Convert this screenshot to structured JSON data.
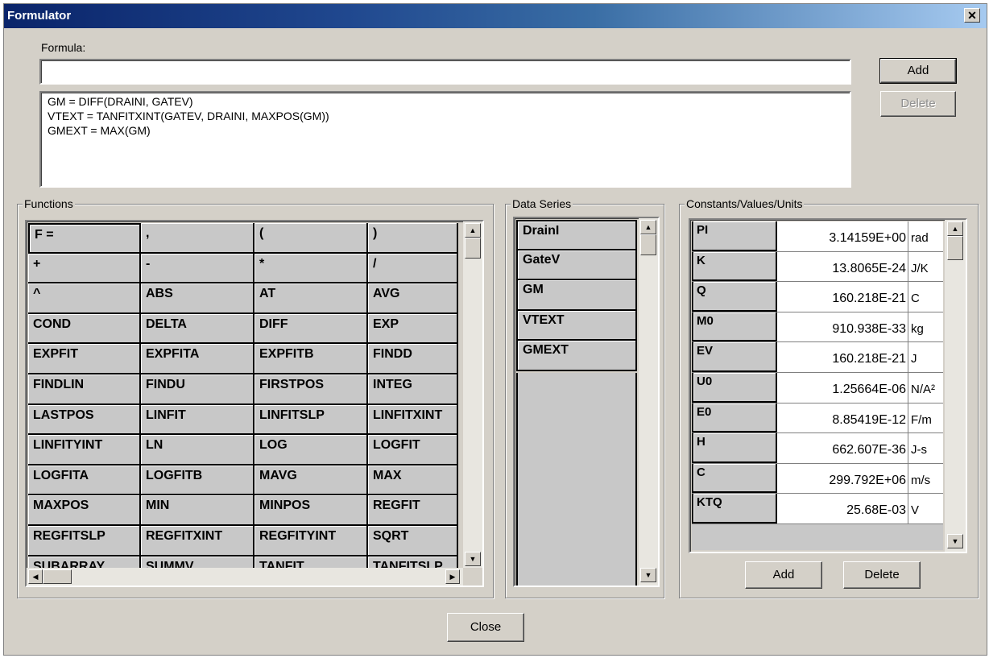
{
  "window": {
    "title": "Formulator",
    "close_glyph": "✕"
  },
  "formula": {
    "label": "Formula:",
    "value": "",
    "add_label": "Add",
    "delete_label": "Delete",
    "list": [
      "GM = DIFF(DRAINI, GATEV)",
      "VTEXT = TANFITXINT(GATEV, DRAINI, MAXPOS(GM))",
      "GMEXT = MAX(GM)"
    ]
  },
  "functions": {
    "title": "Functions",
    "cells": [
      "F =",
      ",",
      "(",
      ")",
      "+",
      "-",
      "*",
      "/",
      "^",
      "ABS",
      "AT",
      "AVG",
      "COND",
      "DELTA",
      "DIFF",
      "EXP",
      "EXPFIT",
      "EXPFITA",
      "EXPFITB",
      "FINDD",
      "FINDLIN",
      "FINDU",
      "FIRSTPOS",
      "INTEG",
      "LASTPOS",
      "LINFIT",
      "LINFITSLP",
      "LINFITXINT",
      "LINFITYINT",
      "LN",
      "LOG",
      "LOGFIT",
      "LOGFITA",
      "LOGFITB",
      "MAVG",
      "MAX",
      "MAXPOS",
      "MIN",
      "MINPOS",
      "REGFIT",
      "REGFITSLP",
      "REGFITXINT",
      "REGFITYINT",
      "SQRT",
      "SUBARRAY",
      "SUMMV",
      "TANFIT",
      "TANFITSLP"
    ]
  },
  "data_series": {
    "title": "Data Series",
    "items": [
      "DrainI",
      "GateV",
      "GM",
      "VTEXT",
      "GMEXT"
    ]
  },
  "constants": {
    "title": "Constants/Values/Units",
    "rows": [
      {
        "name": "PI",
        "value": "3.14159E+00",
        "unit": "rad"
      },
      {
        "name": "K",
        "value": "13.8065E-24",
        "unit": "J/K"
      },
      {
        "name": "Q",
        "value": "160.218E-21",
        "unit": "C"
      },
      {
        "name": "M0",
        "value": "910.938E-33",
        "unit": "kg"
      },
      {
        "name": "EV",
        "value": "160.218E-21",
        "unit": "J"
      },
      {
        "name": "U0",
        "value": "1.25664E-06",
        "unit": "N/A²"
      },
      {
        "name": "E0",
        "value": "8.85419E-12",
        "unit": "F/m"
      },
      {
        "name": "H",
        "value": "662.607E-36",
        "unit": "J-s"
      },
      {
        "name": "C",
        "value": "299.792E+06",
        "unit": "m/s"
      },
      {
        "name": "KTQ",
        "value": "25.68E-03",
        "unit": "V"
      }
    ],
    "add_label": "Add",
    "delete_label": "Delete"
  },
  "footer": {
    "close_label": "Close"
  }
}
